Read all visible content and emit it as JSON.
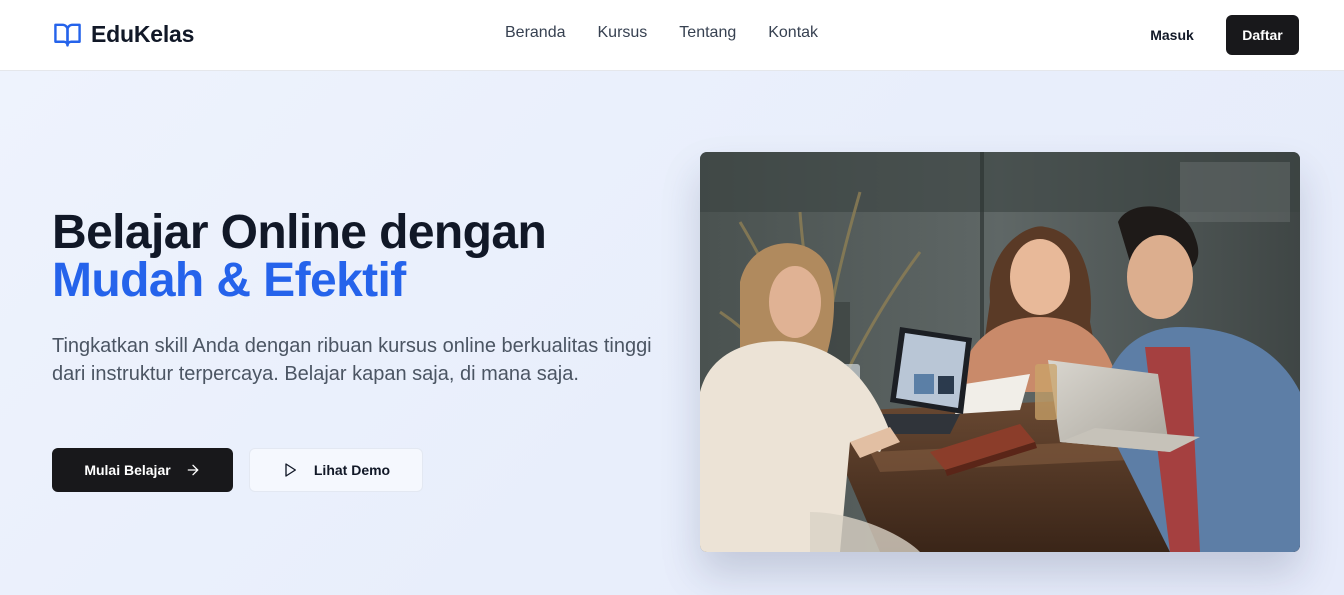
{
  "brand": {
    "name": "EduKelas",
    "icon": "book-open-icon",
    "color": "#2563eb"
  },
  "nav": {
    "links": [
      "Beranda",
      "Kursus",
      "Tentang",
      "Kontak"
    ],
    "login_label": "Masuk",
    "register_label": "Daftar"
  },
  "hero": {
    "title_line1": "Belajar Online dengan",
    "title_line2": "Mudah & Efektif",
    "description": "Tingkatkan skill Anda dengan ribuan kursus online berkualitas tinggi dari instruktur terpercaya. Belajar kapan saja, di mana saja.",
    "primary_button": {
      "label": "Mulai Belajar",
      "icon": "arrow-right-icon"
    },
    "secondary_button": {
      "label": "Lihat Demo",
      "icon": "play-icon"
    },
    "image": {
      "subject": "three people laughing around a wooden table with laptops"
    }
  },
  "colors": {
    "accent": "#2563eb",
    "dark": "#18181b",
    "hero_bg": "#eef3fd"
  }
}
